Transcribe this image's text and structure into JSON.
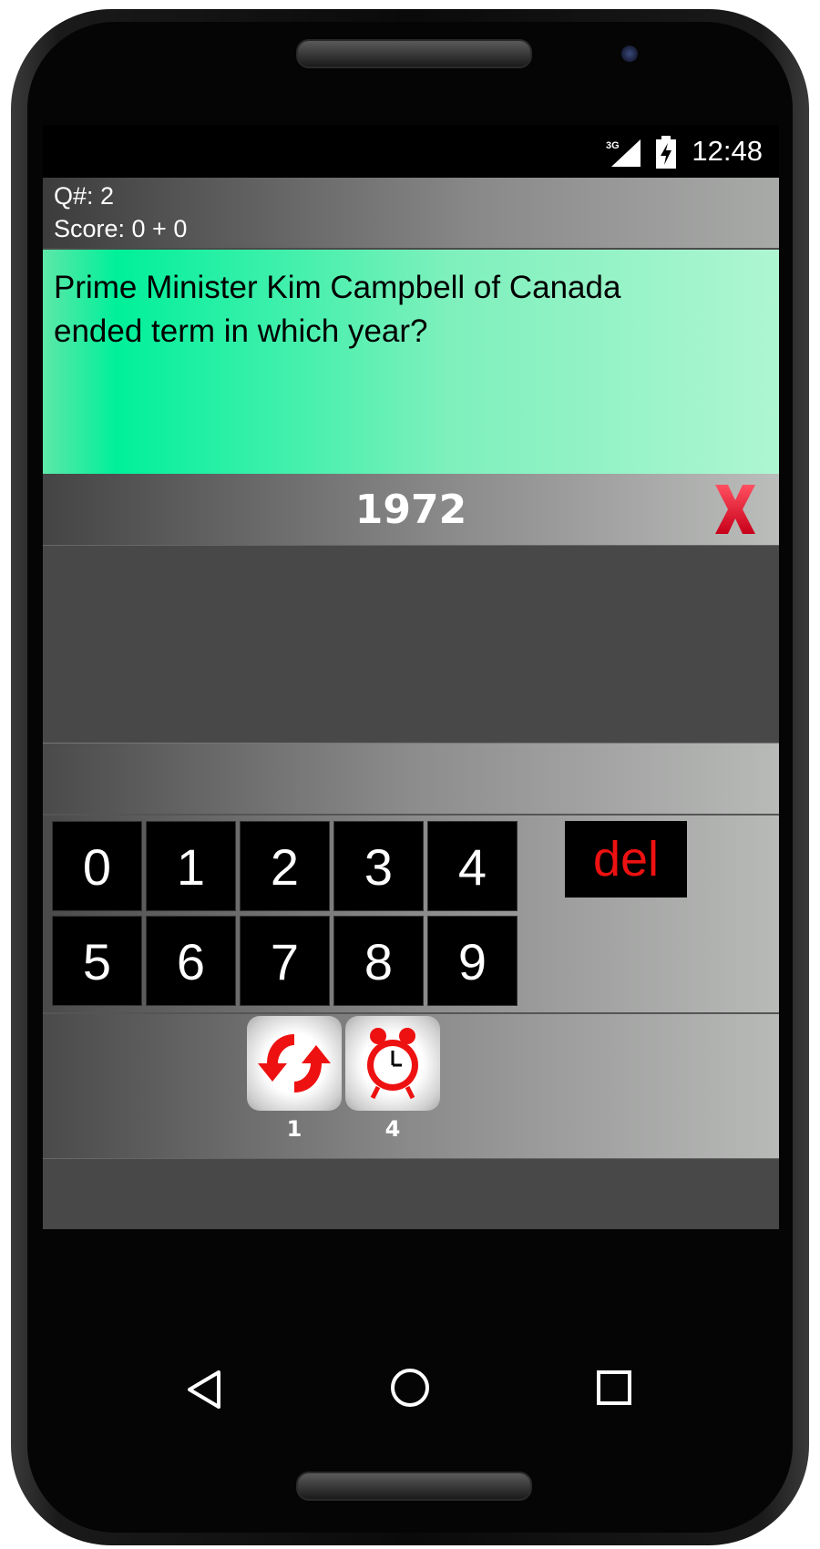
{
  "status_bar": {
    "network": "3G",
    "time": "12:48"
  },
  "header": {
    "question_number": "Q#: 2",
    "score": "Score: 0 + 0"
  },
  "question": {
    "text": "Prime Minister Kim Campbell of Canada ended term in which year?"
  },
  "answer": {
    "value": "1972",
    "clear_icon": "red-x-icon"
  },
  "keypad": {
    "keys_row1": [
      "0",
      "1",
      "2",
      "3",
      "4"
    ],
    "keys_row2": [
      "5",
      "6",
      "7",
      "8",
      "9"
    ],
    "delete_label": "del"
  },
  "powerups": [
    {
      "icon": "refresh-arrows-icon",
      "count": "1"
    },
    {
      "icon": "alarm-clock-icon",
      "count": "4"
    }
  ],
  "nav": {
    "back_icon": "back-triangle-icon",
    "home_icon": "home-circle-icon",
    "recents_icon": "recents-square-icon"
  },
  "colors": {
    "question_bg": "#00f09a",
    "accent_red": "#ee1111",
    "key_bg": "#000000"
  }
}
